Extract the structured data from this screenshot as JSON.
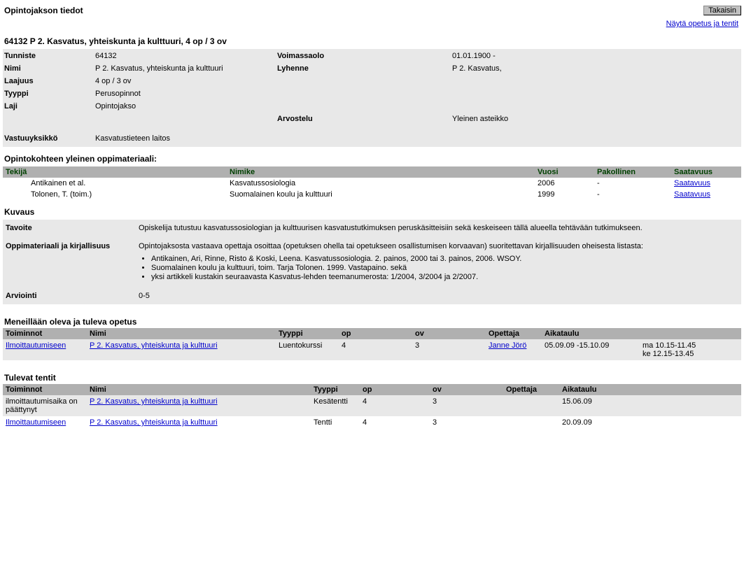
{
  "header": {
    "title": "Opintojakson tiedot",
    "back_button": "Takaisin",
    "show_teaching_link": "Näytä opetus ja tentit"
  },
  "course": {
    "heading": "64132 P 2. Kasvatus, yhteiskunta ja kulttuuri, 4 op / 3 ov",
    "labels": {
      "tunniste": "Tunniste",
      "nimi": "Nimi",
      "laajuus": "Laajuus",
      "tyyppi": "Tyyppi",
      "laji": "Laji",
      "voimassaolo": "Voimassaolo",
      "lyhenne": "Lyhenne",
      "arvostelu": "Arvostelu",
      "vastuuyksikko": "Vastuuyksikkö"
    },
    "values": {
      "tunniste": "64132",
      "nimi": "P 2. Kasvatus, yhteiskunta ja kulttuuri",
      "laajuus": "4 op / 3 ov",
      "tyyppi": "Perusopinnot",
      "laji": "Opintojakso",
      "voimassaolo": "01.01.1900 -",
      "lyhenne": "P 2. Kasvatus,",
      "arvostelu": "Yleinen asteikko",
      "vastuuyksikko": "Kasvatustieteen laitos"
    }
  },
  "materials": {
    "title": "Opintokohteen yleinen oppimateriaali:",
    "headers": {
      "tekija": "Tekijä",
      "nimike": "Nimike",
      "vuosi": "Vuosi",
      "pakollinen": "Pakollinen",
      "saatavuus": "Saatavuus"
    },
    "rows": [
      {
        "tekija": "Antikainen et al.",
        "nimike": "Kasvatussosiologia",
        "vuosi": "2006",
        "pakollinen": "-",
        "saatavuus": "Saatavuus"
      },
      {
        "tekija": "Tolonen, T. (toim.)",
        "nimike": "Suomalainen koulu ja kulttuuri",
        "vuosi": "1999",
        "pakollinen": "-",
        "saatavuus": "Saatavuus"
      }
    ]
  },
  "description": {
    "title": "Kuvaus",
    "labels": {
      "tavoite": "Tavoite",
      "oppimateriaali": "Oppimateriaali ja kirjallisuus",
      "arviointi": "Arviointi"
    },
    "values": {
      "tavoite": "Opiskelija tutustuu kasvatussosiologian ja kulttuurisen kasvatustutkimuksen peruskäsitteisiin sekä keskeiseen tällä alueella tehtävään tutkimukseen.",
      "oppimateriaali_intro": "Opintojaksosta vastaava opettaja osoittaa (opetuksen ohella tai opetukseen osallistumisen korvaavan) suoritettavan kirjallisuuden oheisesta listasta:",
      "oppimateriaali_items": [
        "Antikainen, Ari, Rinne, Risto & Koski, Leena. Kasvatussosiologia. 2. painos, 2000 tai 3. painos, 2006. WSOY.",
        "Suomalainen koulu ja kulttuuri, toim. Tarja Tolonen. 1999. Vastapaino. sekä",
        "yksi artikkeli kustakin seuraavasta Kasvatus-lehden teemanumerosta: 1/2004, 3/2004 ja 2/2007."
      ],
      "arviointi": "0-5"
    }
  },
  "teaching": {
    "title": "Meneillään oleva ja tuleva opetus",
    "headers": {
      "toiminnot": "Toiminnot",
      "nimi": "Nimi",
      "tyyppi": "Tyyppi",
      "op": "op",
      "ov": "ov",
      "opettaja": "Opettaja",
      "aikataulu": "Aikataulu"
    },
    "rows": [
      {
        "toiminnot": "Ilmoittautumiseen",
        "nimi": "P 2. Kasvatus, yhteiskunta ja kulttuuri",
        "tyyppi": "Luentokurssi",
        "op": "4",
        "ov": "3",
        "opettaja": "Janne Jörö",
        "aikataulu_dates": "05.09.09 -15.10.09",
        "aikataulu_times": "ma 10.15-11.45\nke 12.15-13.45"
      }
    ]
  },
  "exams": {
    "title": "Tulevat tentit",
    "headers": {
      "toiminnot": "Toiminnot",
      "nimi": "Nimi",
      "tyyppi": "Tyyppi",
      "op": "op",
      "ov": "ov",
      "opettaja": "Opettaja",
      "aikataulu": "Aikataulu"
    },
    "rows": [
      {
        "toiminnot": "ilmoittautumisaika on päättynyt",
        "toiminnot_link": false,
        "nimi": "P 2. Kasvatus, yhteiskunta ja kulttuuri",
        "tyyppi": "Kesätentti",
        "op": "4",
        "ov": "3",
        "opettaja": "",
        "aikataulu": "15.06.09"
      },
      {
        "toiminnot": "Ilmoittautumiseen",
        "toiminnot_link": true,
        "nimi": "P 2. Kasvatus, yhteiskunta ja kulttuuri",
        "tyyppi": "Tentti",
        "op": "4",
        "ov": "3",
        "opettaja": "",
        "aikataulu": "20.09.09"
      }
    ]
  }
}
